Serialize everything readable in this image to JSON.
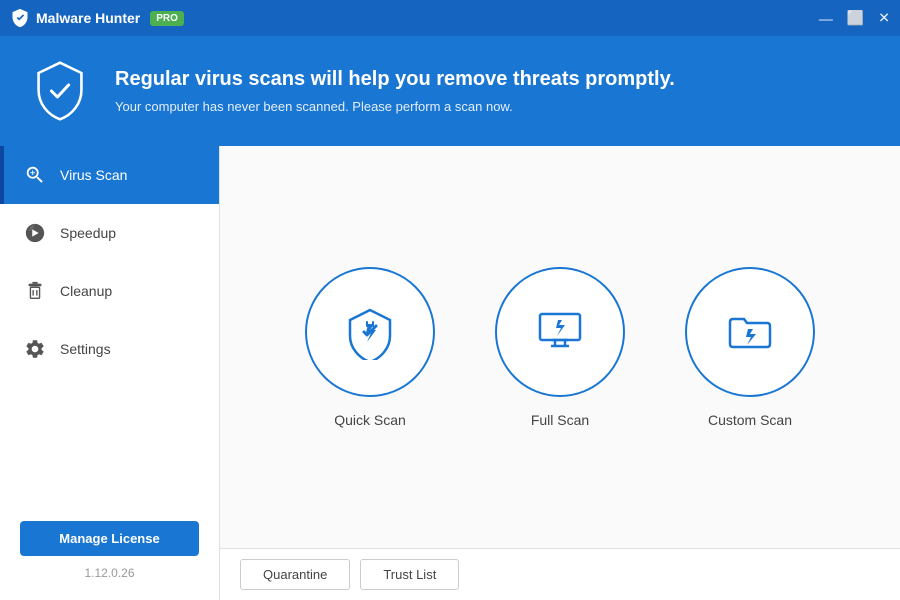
{
  "titlebar": {
    "app_name": "Malware Hunter",
    "pro_badge": "PRO",
    "controls": {
      "minimize": "—",
      "maximize": "⬜",
      "close": "✕"
    }
  },
  "header": {
    "headline": "Regular virus scans will help you remove threats promptly.",
    "subtext": "Your computer has never been scanned. Please perform a scan now."
  },
  "sidebar": {
    "items": [
      {
        "label": "Virus Scan",
        "active": true
      },
      {
        "label": "Speedup",
        "active": false
      },
      {
        "label": "Cleanup",
        "active": false
      },
      {
        "label": "Settings",
        "active": false
      }
    ],
    "manage_license_label": "Manage License",
    "version": "1.12.0.26"
  },
  "scan_options": [
    {
      "label": "Quick Scan"
    },
    {
      "label": "Full Scan"
    },
    {
      "label": "Custom Scan"
    }
  ],
  "bottom_buttons": [
    {
      "label": "Quarantine"
    },
    {
      "label": "Trust List"
    }
  ]
}
